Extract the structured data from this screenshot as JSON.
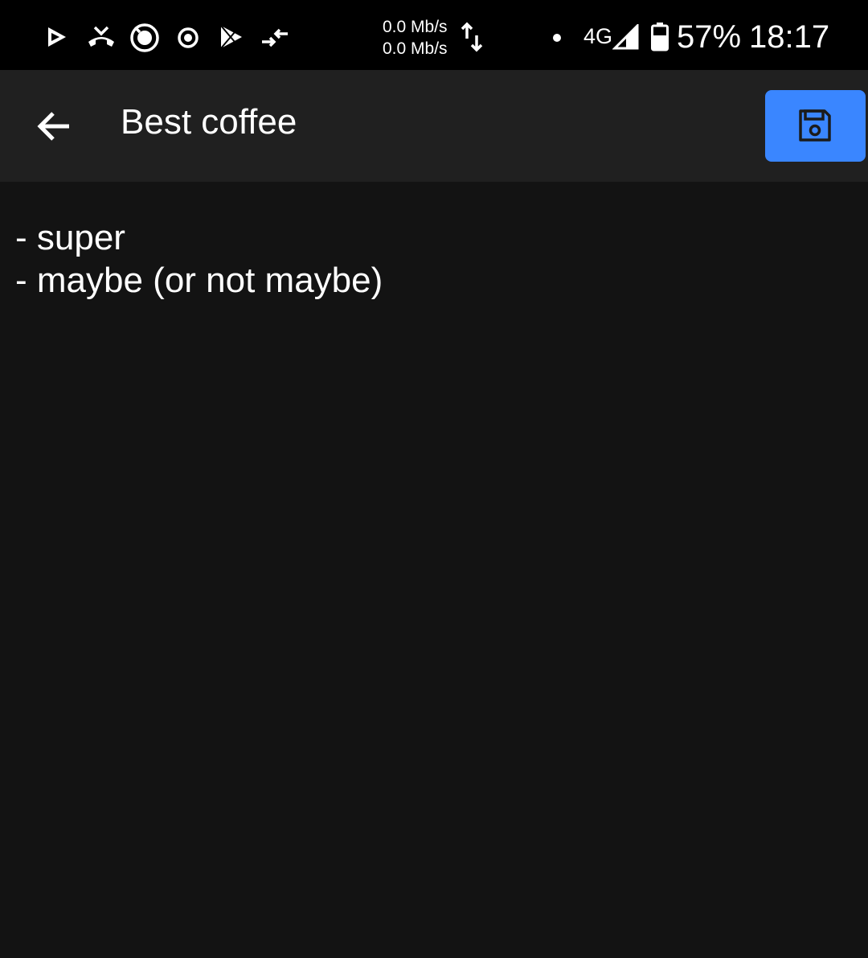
{
  "status_bar": {
    "icons": [
      "play-store-outline-icon",
      "missed-call-icon",
      "target-icon",
      "radio-icon",
      "play-store-icon",
      "data-saver-icon"
    ],
    "net_speed_up": "0.0 Mb/s",
    "net_speed_down": "0.0 Mb/s",
    "network_type": "4G",
    "battery": "57%",
    "time": "18:17"
  },
  "app_bar": {
    "title": "Best coffee",
    "back_icon": "arrow-left-icon",
    "save_icon": "floppy-disk-icon",
    "save_color": "#3a86ff"
  },
  "note": {
    "lines": [
      "- super",
      "- maybe (or not maybe)"
    ]
  }
}
